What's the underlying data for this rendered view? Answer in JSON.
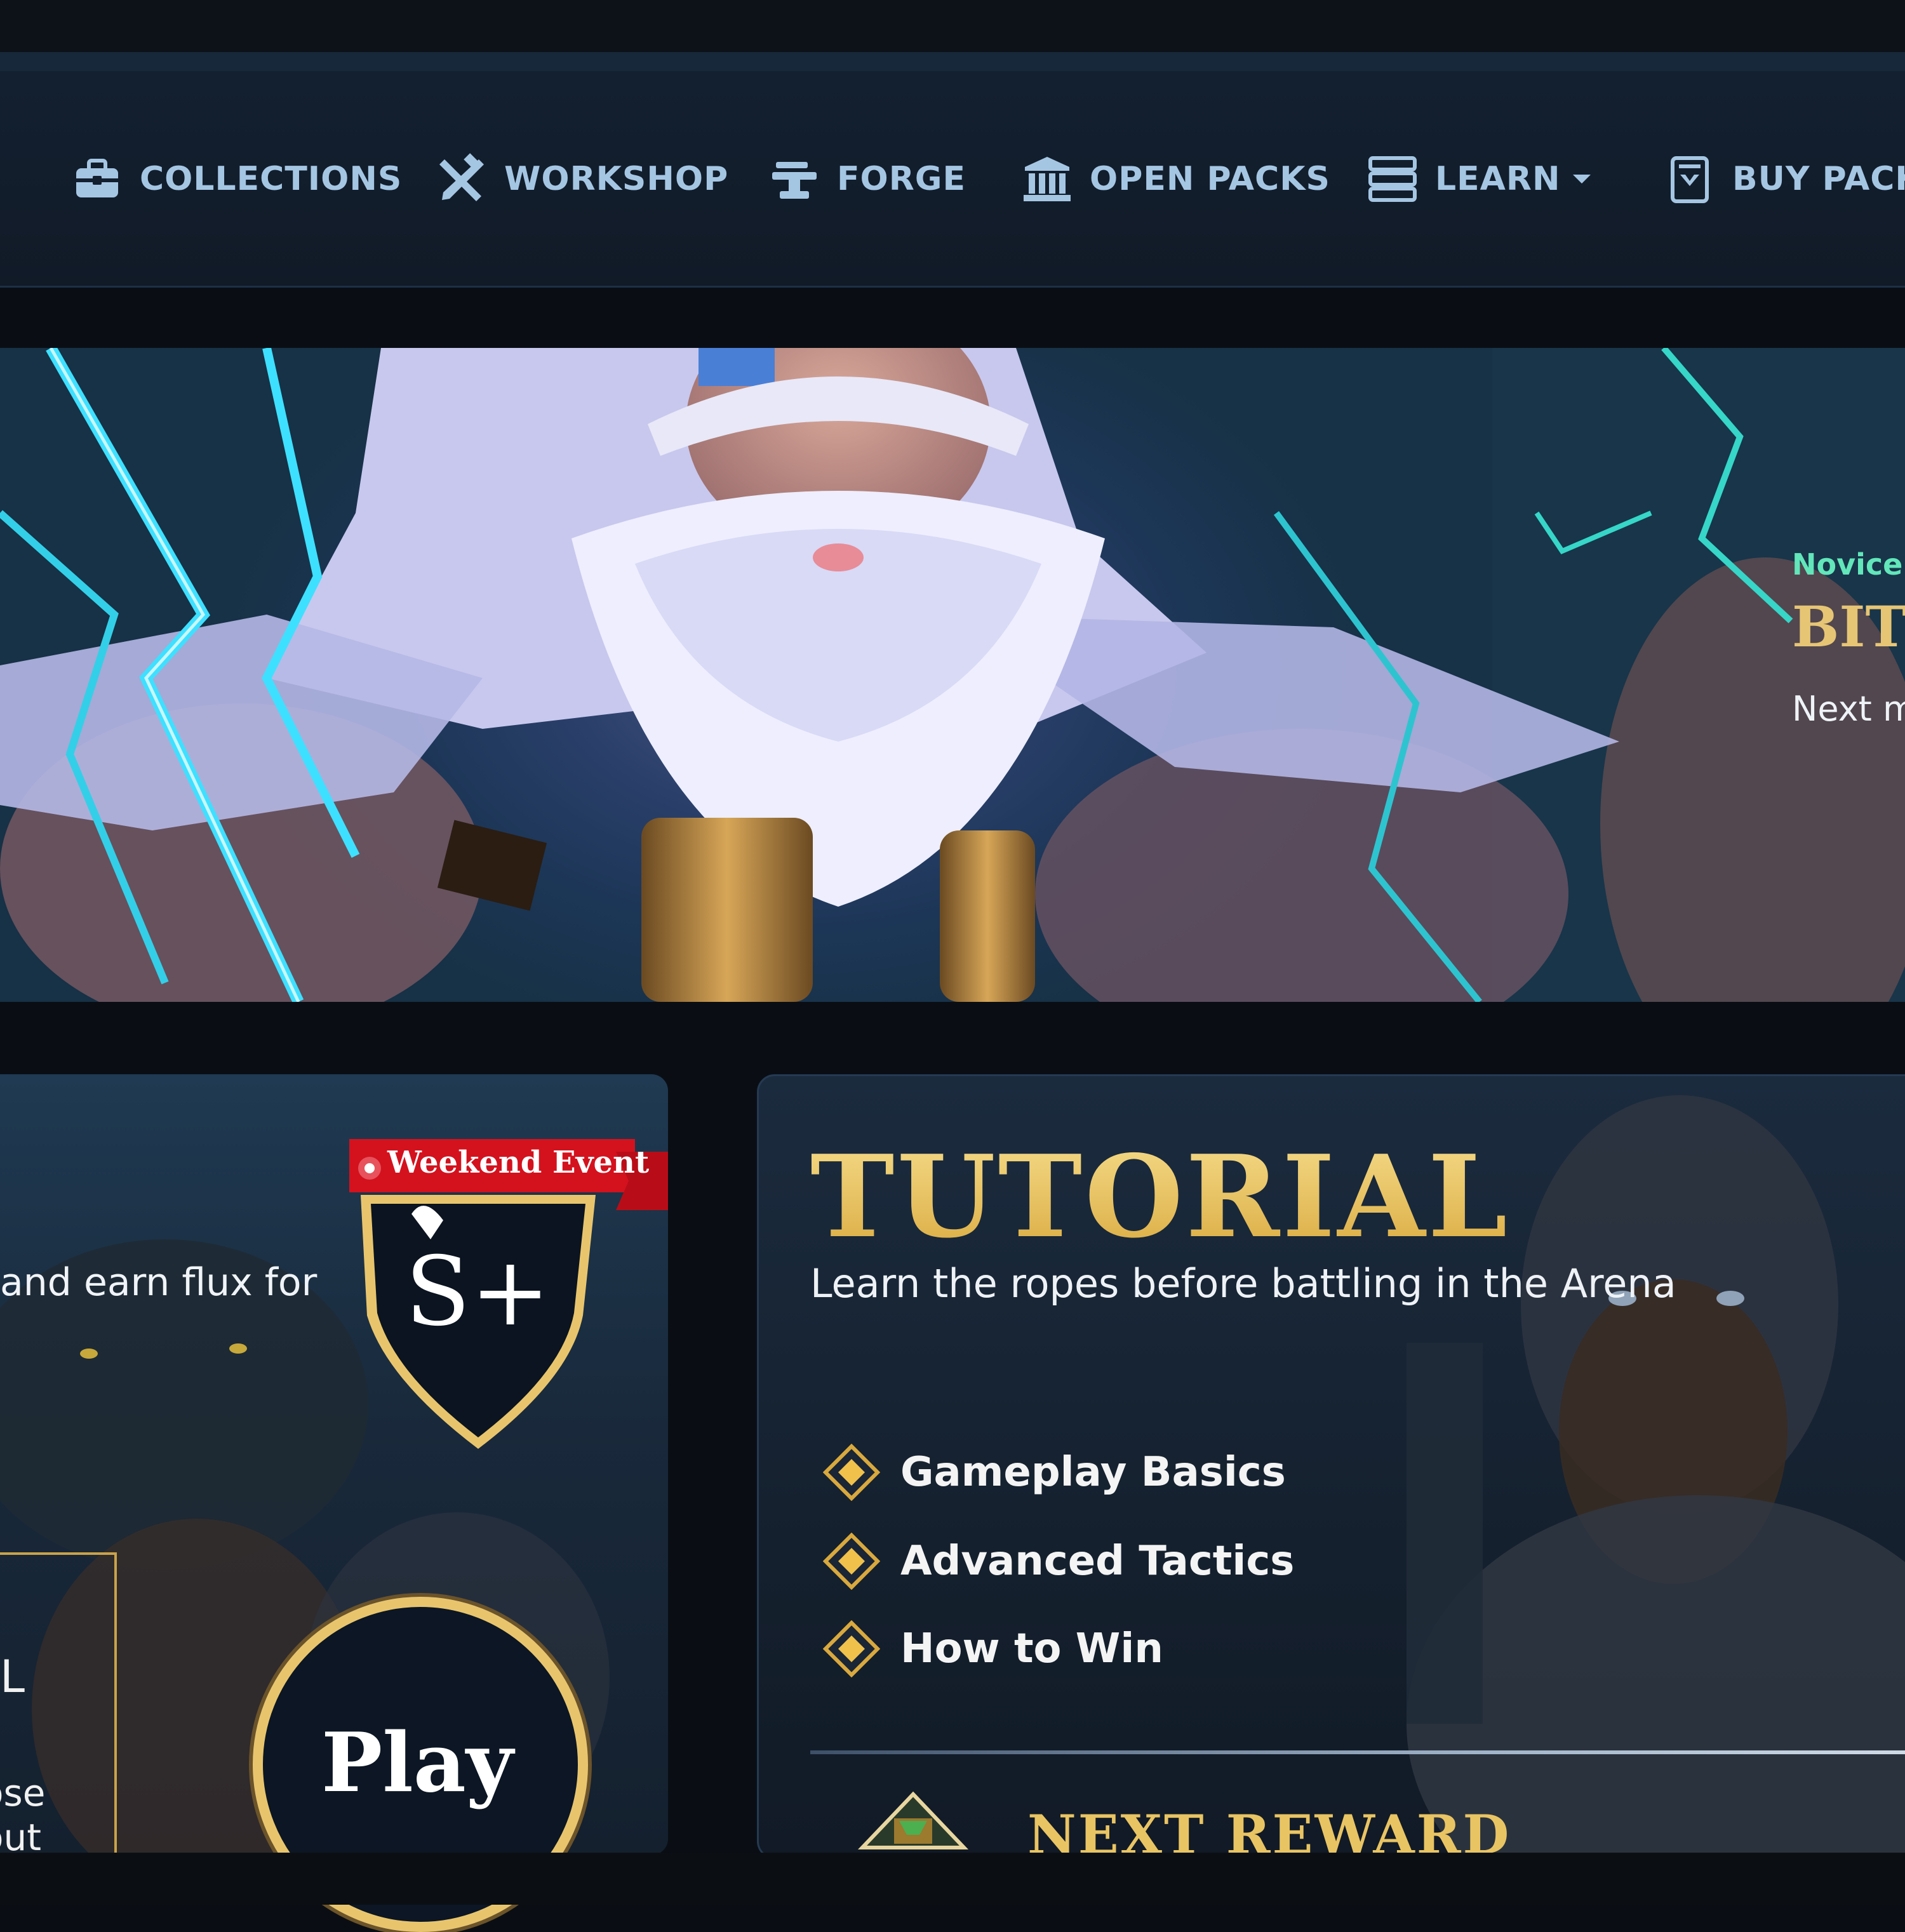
{
  "nav": {
    "items": [
      {
        "label": "COLLECTIONS",
        "icon": "briefcase-icon"
      },
      {
        "label": "WORKSHOP",
        "icon": "crossed-tools-icon"
      },
      {
        "label": "FORGE",
        "icon": "anvil-icon"
      },
      {
        "label": "OPEN PACKS",
        "icon": "temple-icon"
      },
      {
        "label": "LEARN",
        "icon": "book-stack-icon"
      },
      {
        "label": "BUY PACKS",
        "icon": "card-pack-icon"
      }
    ]
  },
  "hero": {
    "tag": "Novice",
    "title": "BITT",
    "subtitle": "Next m"
  },
  "event": {
    "text": "and earn flux for",
    "badge": "Weekend Event",
    "rank": "S+",
    "box_a": "L",
    "box_b": "ose",
    "box_c": "out",
    "play": "Play"
  },
  "tutorial": {
    "title": "TUTORIAL",
    "subtitle": "Learn the ropes before battling in the Arena",
    "items": [
      "Gameplay Basics",
      "Advanced Tactics",
      "How to Win"
    ],
    "next_reward": "NEXT REWARD"
  },
  "colors": {
    "gold": "#e9c463",
    "nav_text": "#a5c6e3",
    "badge_red": "#d3121e",
    "novice_green": "#62e6ba"
  }
}
